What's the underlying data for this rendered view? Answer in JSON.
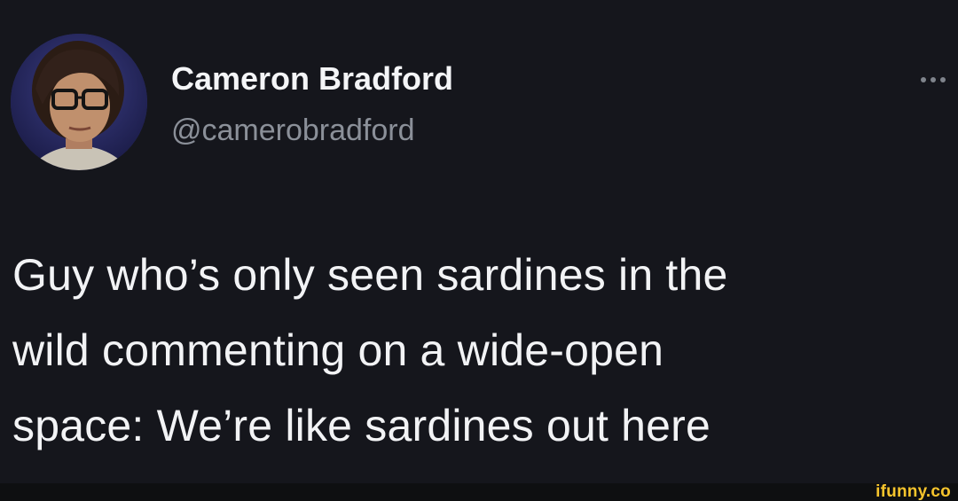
{
  "tweet": {
    "author": {
      "display_name": "Cameron Bradford",
      "handle": "@camerobradford",
      "avatar_icon": "user-avatar-photo"
    },
    "more_icon": "more-options-icon",
    "text_lines": [
      "Guy who’s only seen sardines in the",
      "wild commenting on a wide-open",
      "space: We’re like sardines out here"
    ]
  },
  "watermark": {
    "text": "ifunny.co"
  },
  "colors": {
    "background": "#15161c",
    "text": "#f2f3f5",
    "handle": "#8b9099",
    "watermark": "#f6c42c"
  }
}
